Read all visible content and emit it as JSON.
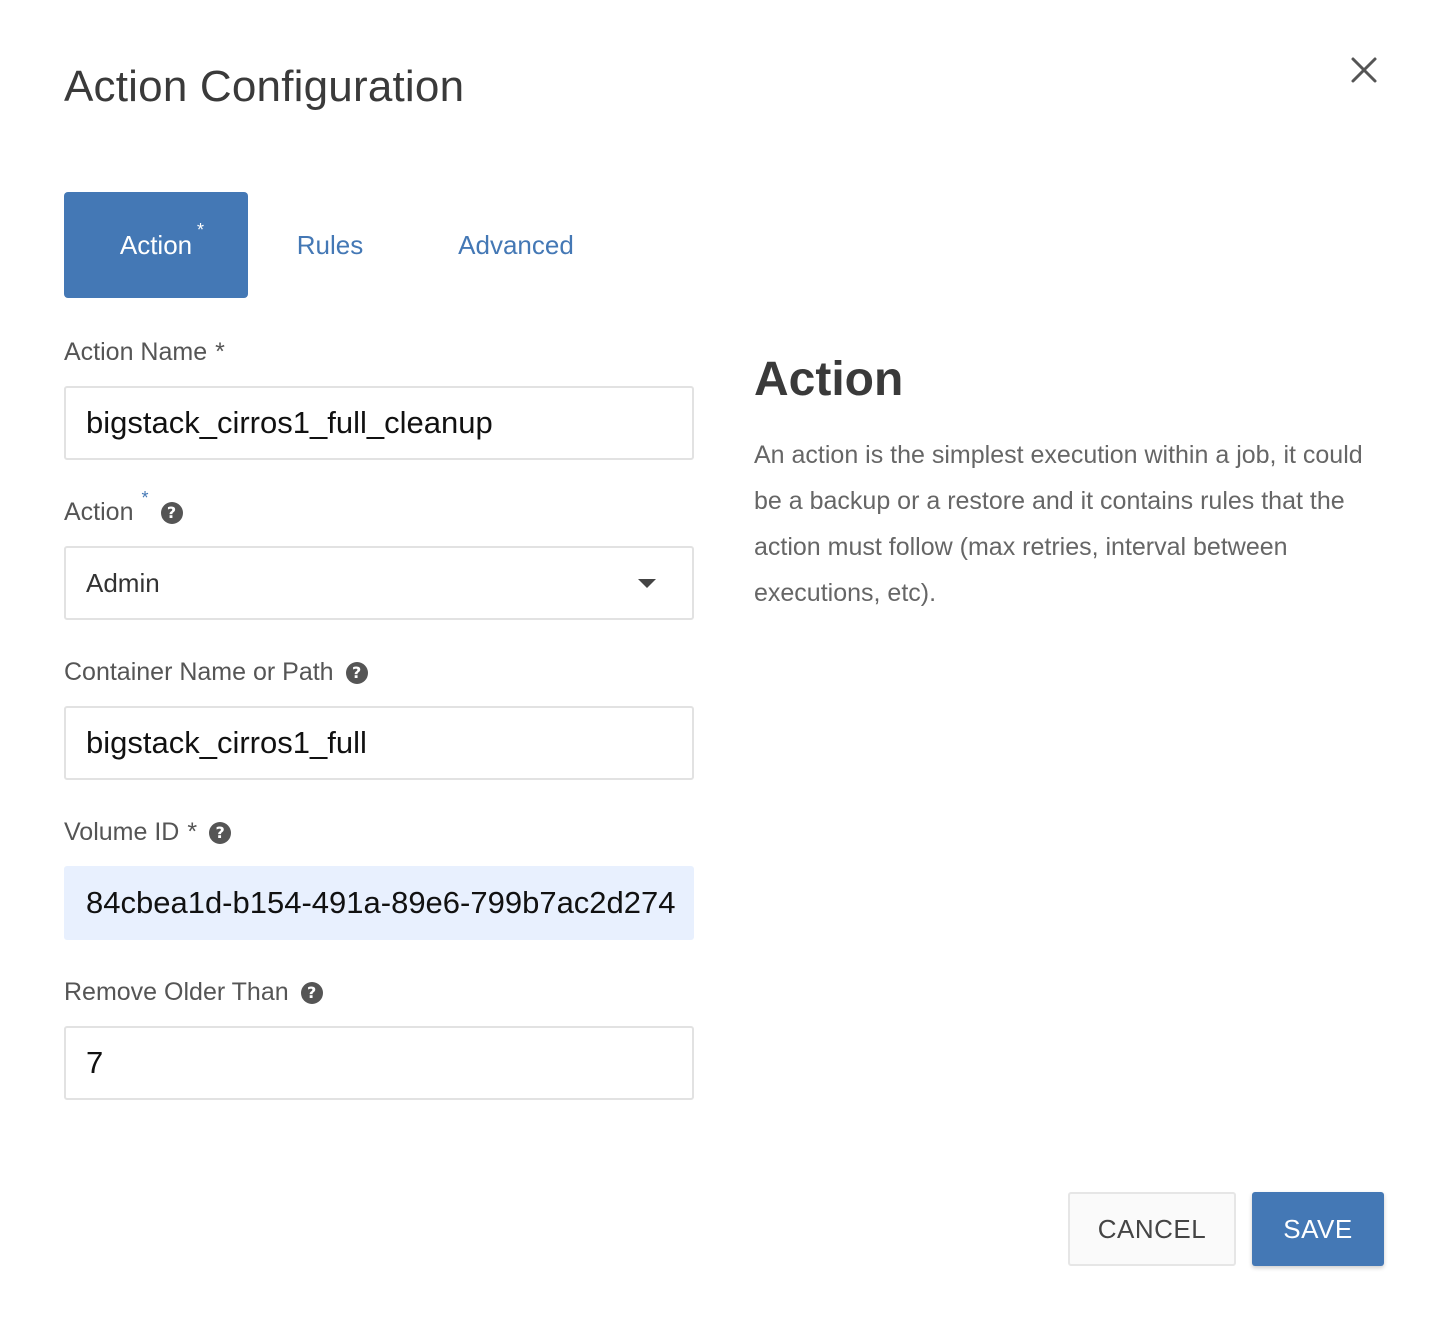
{
  "dialog": {
    "title": "Action Configuration",
    "close_icon": "close-icon"
  },
  "tabs": [
    {
      "label": "Action",
      "required_marker": "*",
      "active": true
    },
    {
      "label": "Rules",
      "active": false
    },
    {
      "label": "Advanced",
      "active": false
    }
  ],
  "form": {
    "action_name": {
      "label": "Action Name",
      "required_marker": "*",
      "value": "bigstack_cirros1_full_cleanup"
    },
    "action": {
      "label": "Action",
      "required_marker": "*",
      "help_icon": "?",
      "selected": "Admin"
    },
    "container": {
      "label": "Container Name or Path",
      "help_icon": "?",
      "value": "bigstack_cirros1_full"
    },
    "volume_id": {
      "label": "Volume ID",
      "required_marker": "*",
      "help_icon": "?",
      "value": "84cbea1d-b154-491a-89e6-799b7ac2d274"
    },
    "remove_older_than": {
      "label": "Remove Older Than",
      "help_icon": "?",
      "value": "7"
    }
  },
  "side_panel": {
    "title": "Action",
    "description": "An action is the simplest execution within a job, it could be a backup or a restore and it contains rules that the action must follow (max retries, interval between executions, etc)."
  },
  "buttons": {
    "cancel": "CANCEL",
    "save": "SAVE"
  },
  "colors": {
    "accent": "#4478b5",
    "autofill_bg": "#e8f0fe"
  }
}
